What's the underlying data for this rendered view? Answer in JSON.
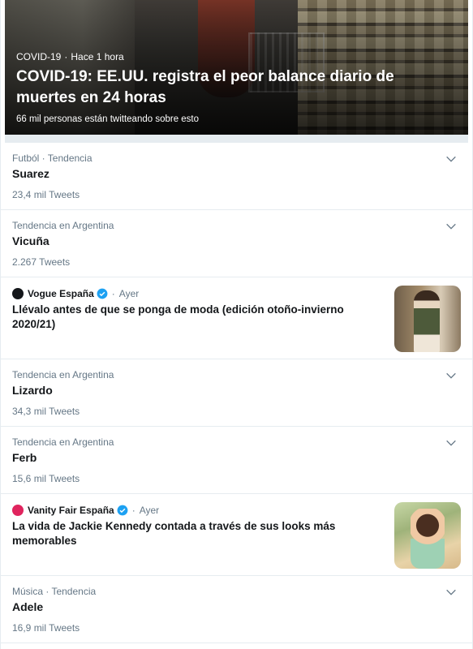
{
  "hero": {
    "category": "COVID-19",
    "time": "Hace 1 hora",
    "title": "COVID-19: EE.UU. registra el peor balance diario de muertes en 24 horas",
    "subtitle": "66 mil personas están twitteando sobre esto"
  },
  "trends": [
    {
      "context": "Futból · Tendencia",
      "name": "Suarez",
      "count": "23,4 mil Tweets"
    },
    {
      "context": "Tendencia en Argentina",
      "name": "Vicuña",
      "count": "2.267 Tweets"
    },
    {
      "context": "Tendencia en Argentina",
      "name": "Lizardo",
      "count": "34,3 mil Tweets"
    },
    {
      "context": "Tendencia en Argentina",
      "name": "Ferb",
      "count": "15,6 mil Tweets"
    },
    {
      "context": "Música · Tendencia",
      "name": "Adele",
      "count": "16,9 mil Tweets"
    }
  ],
  "stories": [
    {
      "source": "Vogue España",
      "time": "Ayer",
      "headline": "Llévalo antes de que se ponga de moda (edición otoño-invierno 2020/21)",
      "logo_color": "#14171a"
    },
    {
      "source": "Vanity Fair España",
      "time": "Ayer",
      "headline": "La vida de Jackie Kennedy contada a través de sus looks más memorables",
      "logo_color": "#e0245e"
    }
  ],
  "colors": {
    "verified": "#1da1f2",
    "muted": "#657786",
    "text": "#14171a"
  }
}
